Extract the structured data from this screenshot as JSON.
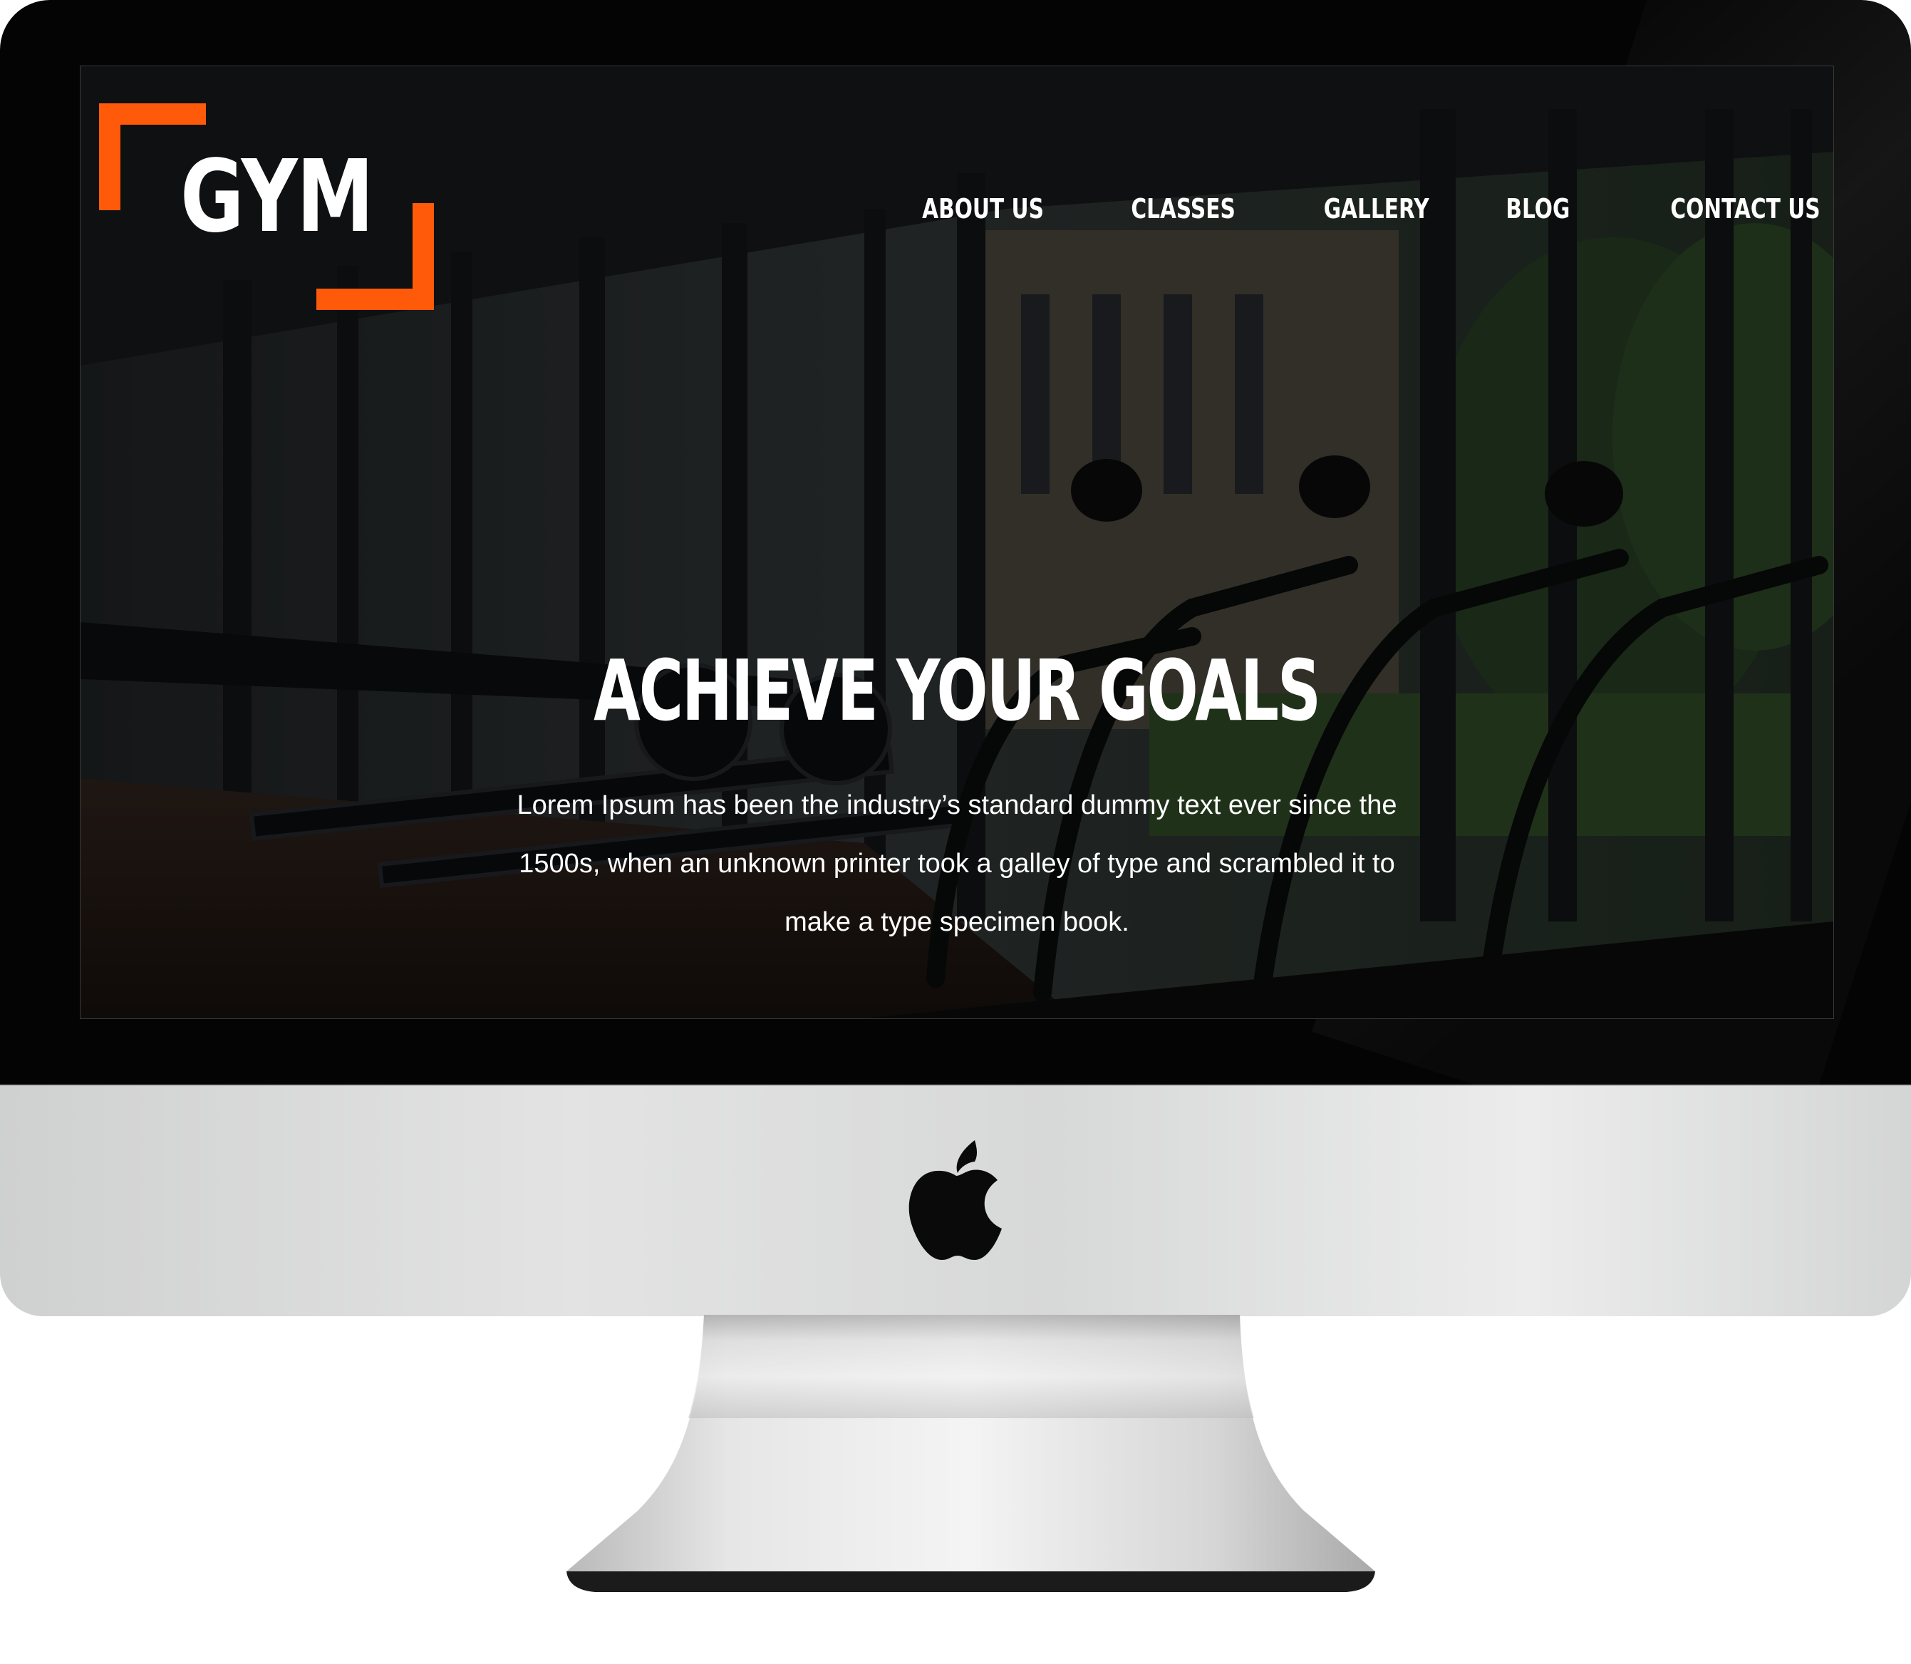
{
  "site": {
    "logo_text": "GYM",
    "accent_color": "#ff5a0a"
  },
  "nav": {
    "items": [
      {
        "label": "ABOUT US"
      },
      {
        "label": "CLASSES"
      },
      {
        "label": "GALLERY"
      },
      {
        "label": "BLOG"
      },
      {
        "label": "CONTACT US"
      }
    ]
  },
  "hero": {
    "title": "ACHIEVE YOUR GOALS",
    "text": "Lorem Ipsum has been the industry’s standard dummy text ever since the 1500s, when an unknown printer took a galley of type and scrambled it to make a type specimen book."
  },
  "device": {
    "logo_icon": "apple-icon"
  }
}
